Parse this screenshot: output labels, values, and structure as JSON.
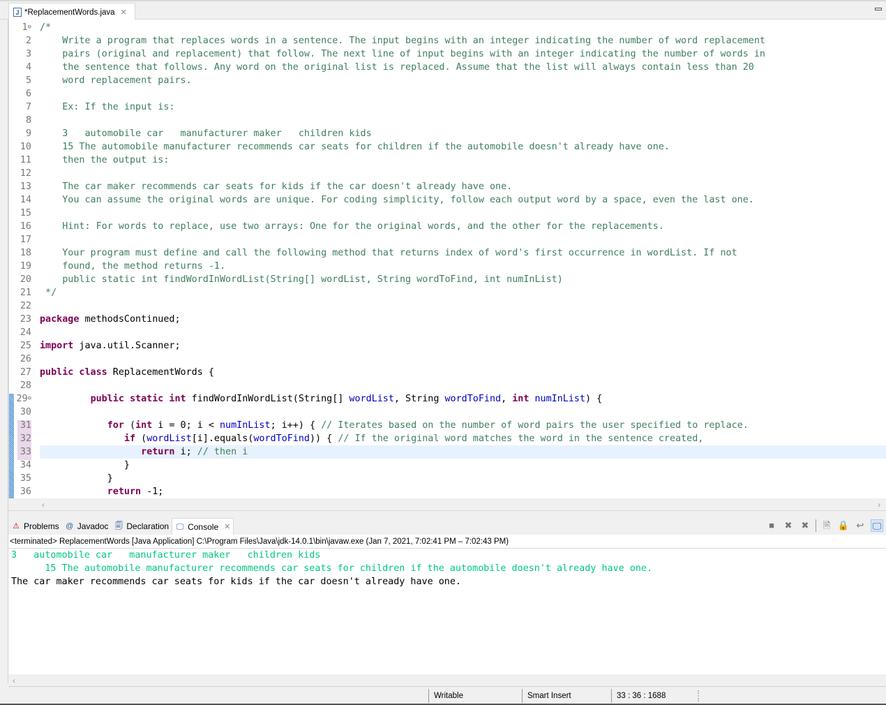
{
  "editor": {
    "tab_title": "*ReplacementWords.java",
    "tab_close": "✕",
    "current_line": 33,
    "lines": [
      {
        "n": "1",
        "fold": true,
        "parts": [
          [
            "c",
            "/*"
          ]
        ]
      },
      {
        "n": "2",
        "parts": [
          [
            "c",
            "    Write a program that replaces words in a sentence. The input begins with an integer indicating the number of word replacement"
          ]
        ]
      },
      {
        "n": "3",
        "parts": [
          [
            "c",
            "    pairs (original and replacement) that follow. The next line of input begins with an integer indicating the number of words in"
          ]
        ]
      },
      {
        "n": "4",
        "parts": [
          [
            "c",
            "    the sentence that follows. Any word on the original list is replaced. Assume that the list will always contain less than 20"
          ]
        ]
      },
      {
        "n": "5",
        "parts": [
          [
            "c",
            "    word replacement pairs."
          ]
        ]
      },
      {
        "n": "6",
        "parts": []
      },
      {
        "n": "7",
        "parts": [
          [
            "c",
            "    Ex: If the input is:"
          ]
        ]
      },
      {
        "n": "8",
        "parts": []
      },
      {
        "n": "9",
        "parts": [
          [
            "c",
            "    3   automobile car   manufacturer maker   children kids"
          ]
        ]
      },
      {
        "n": "10",
        "parts": [
          [
            "c",
            "    15 The automobile manufacturer recommends car seats for children if the automobile doesn't already have one."
          ]
        ]
      },
      {
        "n": "11",
        "parts": [
          [
            "c",
            "    then the output is:"
          ]
        ]
      },
      {
        "n": "12",
        "parts": []
      },
      {
        "n": "13",
        "parts": [
          [
            "c",
            "    The car maker recommends car seats for kids if the car doesn't already have one."
          ]
        ]
      },
      {
        "n": "14",
        "parts": [
          [
            "c",
            "    You can assume the original words are unique. For coding simplicity, follow each output word by a space, even the last one."
          ]
        ]
      },
      {
        "n": "15",
        "parts": []
      },
      {
        "n": "16",
        "parts": [
          [
            "c",
            "    Hint: For words to replace, use two arrays: One for the original words, and the other for the replacements."
          ]
        ]
      },
      {
        "n": "17",
        "parts": []
      },
      {
        "n": "18",
        "parts": [
          [
            "c",
            "    Your program must define and call the following method that returns index of word's first occurrence in wordList. If not"
          ]
        ]
      },
      {
        "n": "19",
        "parts": [
          [
            "c",
            "    found, the method returns -1."
          ]
        ]
      },
      {
        "n": "20",
        "parts": [
          [
            "c",
            "    public static int findWordInWordList(String[] wordList, String wordToFind, int numInList)"
          ]
        ]
      },
      {
        "n": "21",
        "parts": [
          [
            "c",
            " */"
          ]
        ]
      },
      {
        "n": "22",
        "parts": []
      },
      {
        "n": "23",
        "parts": [
          [
            "k",
            "package"
          ],
          [
            "",
            "methodsContinued;"
          ]
        ]
      },
      {
        "n": "24",
        "parts": []
      },
      {
        "n": "25",
        "parts": [
          [
            "k",
            "import"
          ],
          [
            "",
            " java.util.Scanner;"
          ]
        ]
      },
      {
        "n": "26",
        "parts": []
      },
      {
        "n": "27",
        "parts": [
          [
            "k",
            "public class"
          ],
          [
            "",
            " ReplacementWords {"
          ]
        ]
      },
      {
        "n": "28",
        "parts": []
      },
      {
        "n": "29",
        "fold": true,
        "parts": [
          [
            "",
            "         "
          ],
          [
            "k",
            "public static int"
          ],
          [
            "",
            " findWordInWordList(String[] "
          ],
          [
            "v",
            "wordList"
          ],
          [
            "",
            ", String "
          ],
          [
            "v",
            "wordToFind"
          ],
          [
            "",
            ", "
          ],
          [
            "k",
            "int"
          ],
          [
            "",
            " "
          ],
          [
            "v",
            "numInList"
          ],
          [
            "",
            ") {"
          ]
        ]
      },
      {
        "n": "30",
        "parts": []
      },
      {
        "n": "31",
        "parts": [
          [
            "",
            "            "
          ],
          [
            "k",
            "for"
          ],
          [
            "",
            " ("
          ],
          [
            "k",
            "int"
          ],
          [
            "",
            " i = 0; i < "
          ],
          [
            "v",
            "numInList"
          ],
          [
            "",
            "; i++) { "
          ],
          [
            "c",
            "// Iterates based on the number of word pairs the user specified to replace."
          ]
        ]
      },
      {
        "n": "32",
        "parts": [
          [
            "",
            "               "
          ],
          [
            "k",
            "if"
          ],
          [
            "",
            " ("
          ],
          [
            "v",
            "wordList"
          ],
          [
            "",
            "[i].equals("
          ],
          [
            "v",
            "wordToFind"
          ],
          [
            "",
            ")) { "
          ],
          [
            "c",
            "// If the original word matches the word in the sentence created,"
          ]
        ]
      },
      {
        "n": "33",
        "parts": [
          [
            "",
            "                  "
          ],
          [
            "k",
            "return"
          ],
          [
            "",
            " i; "
          ],
          [
            "c",
            "// then i"
          ]
        ]
      },
      {
        "n": "34",
        "parts": [
          [
            "",
            "               }"
          ]
        ]
      },
      {
        "n": "35",
        "parts": [
          [
            "",
            "            }"
          ]
        ]
      },
      {
        "n": "36",
        "parts": [
          [
            "",
            "            "
          ],
          [
            "k",
            "return"
          ],
          [
            "",
            " -1;"
          ]
        ]
      }
    ]
  },
  "console": {
    "tabs": [
      {
        "label": "Problems",
        "icon": "problems-icon"
      },
      {
        "label": "Javadoc",
        "icon": "javadoc-icon"
      },
      {
        "label": "Declaration",
        "icon": "declaration-icon"
      },
      {
        "label": "Console",
        "icon": "console-icon",
        "active": true
      }
    ],
    "close": "✕",
    "info": "<terminated> ReplacementWords [Java Application] C:\\Program Files\\Java\\jdk-14.0.1\\bin\\javaw.exe  (Jan 7, 2021, 7:02:41 PM – 7:02:43 PM)",
    "output": [
      {
        "type": "in",
        "text": "3   automobile car   manufacturer maker   children kids"
      },
      {
        "type": "in",
        "text": "      15 The automobile manufacturer recommends car seats for children if the automobile doesn't already have one."
      },
      {
        "type": "out",
        "text": "The car maker recommends car seats for kids if the car doesn't already have one."
      }
    ],
    "toolbar": [
      {
        "name": "terminate-icon",
        "glyph": "■"
      },
      {
        "name": "remove-launch-icon",
        "glyph": "✖"
      },
      {
        "name": "remove-all-icon",
        "glyph": "✖"
      },
      {
        "name": "clear-console-icon",
        "glyph": "🗎"
      },
      {
        "name": "scroll-lock-icon",
        "glyph": "🔒"
      },
      {
        "name": "word-wrap-icon",
        "glyph": "↩"
      },
      {
        "name": "display-console-icon",
        "glyph": "🖵",
        "active": true
      }
    ]
  },
  "statusbar": {
    "writable": "Writable",
    "insert_mode": "Smart Insert",
    "position": "33 : 36 : 1688"
  }
}
